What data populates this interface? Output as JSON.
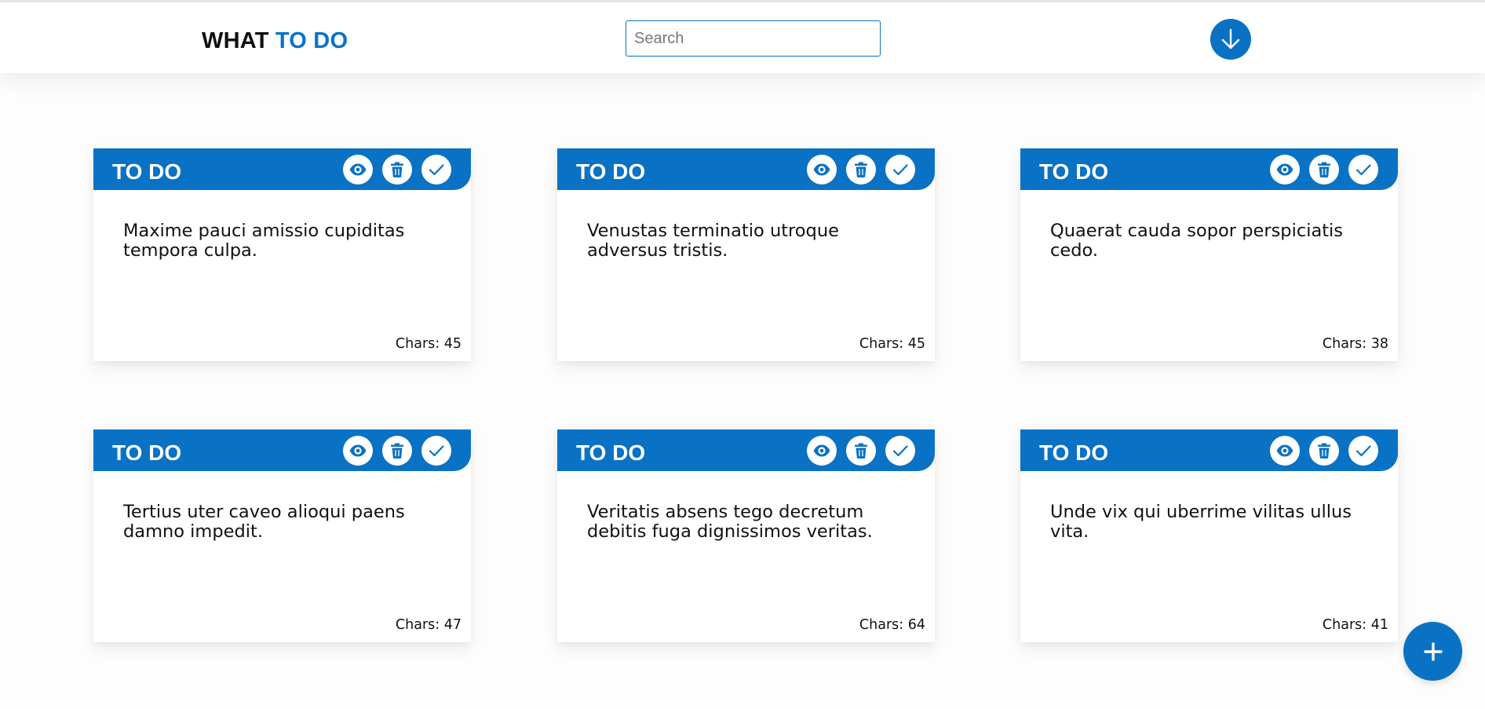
{
  "header": {
    "logo_part1": "WHAT",
    "logo_part2": "TO DO",
    "search_placeholder": "Search",
    "search_value": "",
    "sort_icon": "arrow-down-icon"
  },
  "colors": {
    "accent": "#0a72c4",
    "text": "#111111",
    "background": "#fdfdfd"
  },
  "cards": [
    {
      "title": "TO DO",
      "text": "Maxime pauci amissio cupiditas tempora culpa.",
      "chars": "Chars: 45"
    },
    {
      "title": "TO DO",
      "text": "Venustas terminatio utroque adversus tristis.",
      "chars": "Chars: 45"
    },
    {
      "title": "TO DO",
      "text": "Quaerat cauda sopor perspiciatis cedo.",
      "chars": "Chars: 38"
    },
    {
      "title": "TO DO",
      "text": "Tertius uter caveo alioqui paens damno impedit.",
      "chars": "Chars: 47"
    },
    {
      "title": "TO DO",
      "text": "Veritatis absens tego decretum debitis fuga dignissimos veritas.",
      "chars": "Chars: 64"
    },
    {
      "title": "TO DO",
      "text": "Unde vix qui uberrime vilitas ullus vita.",
      "chars": "Chars: 41"
    }
  ],
  "card_icons": [
    "eye-icon",
    "trash-icon",
    "check-icon"
  ],
  "fab_icon": "plus-icon"
}
